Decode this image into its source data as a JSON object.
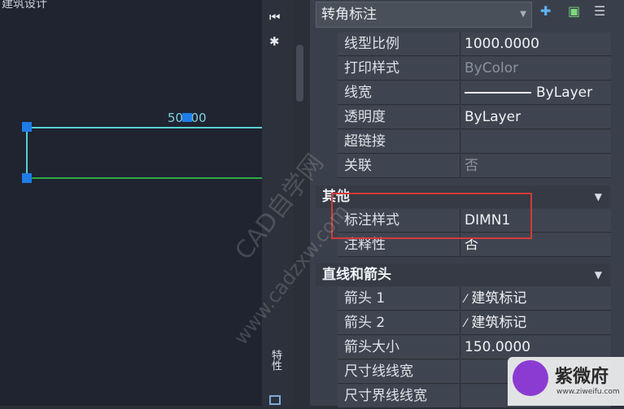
{
  "canvas": {
    "title": "建筑设计",
    "dimension_text": "50000"
  },
  "side_strip": {
    "tab_label": "特性"
  },
  "panel": {
    "selector": "转角标注",
    "rows_general": [
      {
        "label": "线型比例",
        "value": "1000.0000"
      },
      {
        "label": "打印样式",
        "value": "ByColor"
      },
      {
        "label": "线宽",
        "value": "ByLayer"
      },
      {
        "label": "透明度",
        "value": "ByLayer"
      },
      {
        "label": "超链接",
        "value": ""
      },
      {
        "label": "关联",
        "value": "否"
      }
    ],
    "section_misc": "其他",
    "rows_misc": [
      {
        "label": "标注样式",
        "value": "DIMN1"
      },
      {
        "label": "注释性",
        "value": "否"
      }
    ],
    "section_lines": "直线和箭头",
    "rows_lines": [
      {
        "label": "箭头 1",
        "value": "建筑标记"
      },
      {
        "label": "箭头 2",
        "value": "建筑标记"
      },
      {
        "label": "箭头大小",
        "value": "150.0000"
      },
      {
        "label": "尺寸线线宽",
        "value": ""
      },
      {
        "label": "尺寸界线线宽",
        "value": ""
      }
    ]
  },
  "watermark": {
    "line1": "CAD自学网",
    "line2": "www.cadzxw.com"
  },
  "logo": {
    "name": "紫微府",
    "url": "www.ziweifu.com"
  }
}
